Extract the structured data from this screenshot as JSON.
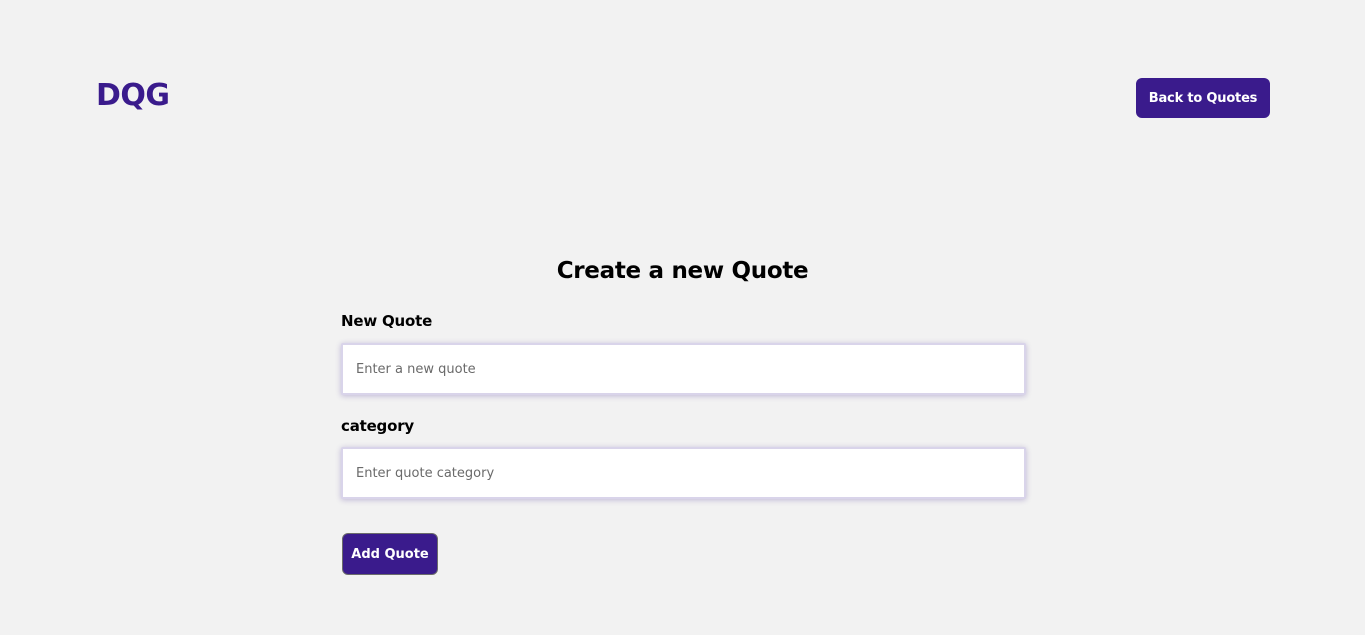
{
  "header": {
    "logo_text": "DQG",
    "back_button_label": "Back to Quotes"
  },
  "form": {
    "title": "Create a new Quote",
    "quote_field": {
      "label": "New Quote",
      "value": "",
      "placeholder": "Enter a new quote"
    },
    "category_field": {
      "label": "category",
      "value": "",
      "placeholder": "Enter quote category"
    },
    "submit_label": "Add Quote"
  },
  "colors": {
    "brand": "#3a1b8c",
    "background": "#f2f2f2"
  }
}
